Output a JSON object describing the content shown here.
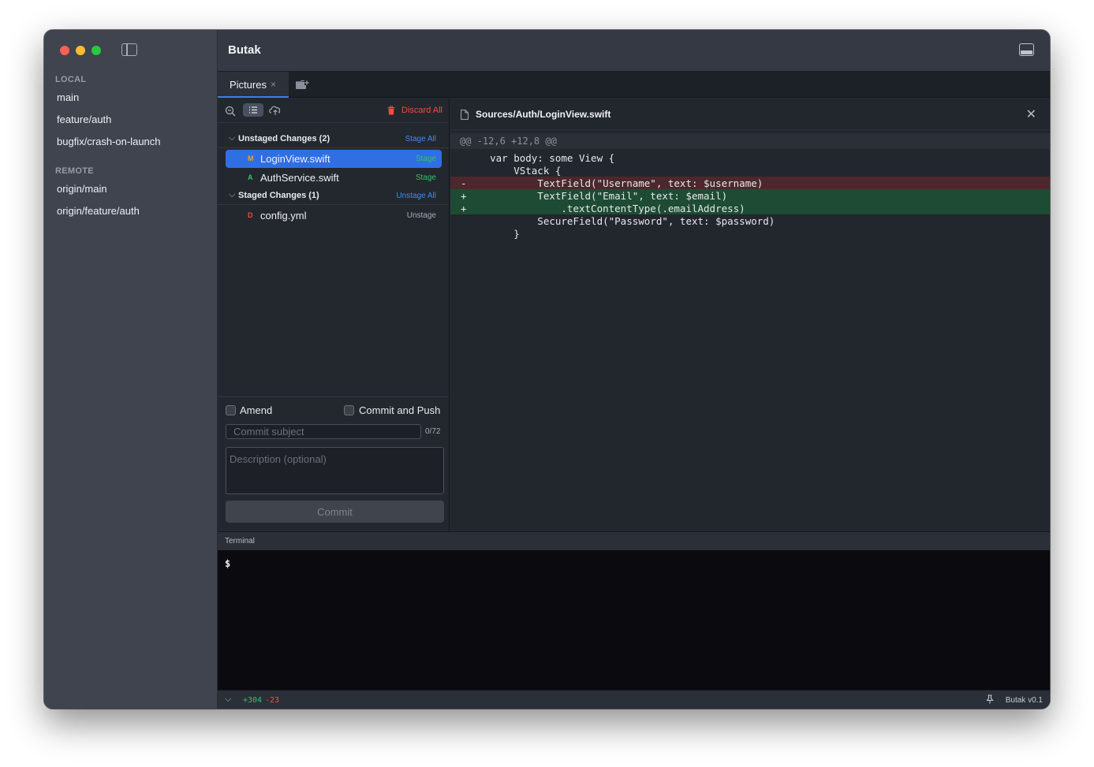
{
  "sidebar": {
    "local_title": "LOCAL",
    "local_branches": [
      "main",
      "feature/auth",
      "bugfix/crash-on-launch"
    ],
    "remote_title": "REMOTE",
    "remote_branches": [
      "origin/main",
      "origin/feature/auth"
    ]
  },
  "header": {
    "title": "Butak"
  },
  "tabs": [
    {
      "label": "Pictures",
      "close": "×"
    }
  ],
  "toolbar": {
    "discard_all": "Discard All"
  },
  "unstaged": {
    "title": "Unstaged Changes (2)",
    "action": "Stage All",
    "files": [
      {
        "status": "M",
        "status_color": "#f0a030",
        "name": "LoginView.swift",
        "action": "Stage",
        "selected": true
      },
      {
        "status": "A",
        "status_color": "#36c26e",
        "name": "AuthService.swift",
        "action": "Stage",
        "selected": false
      }
    ]
  },
  "staged": {
    "title": "Staged Changes (1)",
    "action": "Unstage All",
    "files": [
      {
        "status": "D",
        "status_color": "#ef4c43",
        "name": "config.yml",
        "action": "Unstage",
        "selected": false
      }
    ]
  },
  "commit": {
    "amend_label": "Amend",
    "push_label": "Commit and Push",
    "subject_placeholder": "Commit subject",
    "char_count": "0/72",
    "description_placeholder": "Description (optional)",
    "button_label": "Commit"
  },
  "diff": {
    "path": "Sources/Auth/LoginView.swift",
    "hunk_header": "@@ -12,6 +12,8 @@",
    "lines": [
      {
        "type": "context",
        "marker": " ",
        "text": "    var body: some View {"
      },
      {
        "type": "context",
        "marker": " ",
        "text": "        VStack {"
      },
      {
        "type": "removed",
        "marker": "-",
        "text": "            TextField(\"Username\", text: $username)"
      },
      {
        "type": "added",
        "marker": "+",
        "text": "            TextField(\"Email\", text: $email)"
      },
      {
        "type": "added",
        "marker": "+",
        "text": "                .textContentType(.emailAddress)"
      },
      {
        "type": "context",
        "marker": " ",
        "text": "            SecureField(\"Password\", text: $password)"
      },
      {
        "type": "context",
        "marker": " ",
        "text": "        }"
      }
    ]
  },
  "terminal": {
    "label": "Terminal",
    "prompt": "$"
  },
  "status": {
    "additions": "+304",
    "deletions": "-23",
    "version": "Butak v0.1"
  },
  "colors": {
    "accent": "#3d7df0",
    "stage_green": "#34c06b",
    "unstage_gray": "#a7abb4",
    "discard_red": "#ef4c43"
  },
  "icons": [
    "sidebar-toggle-icon",
    "panel-toggle-icon",
    "new-tab-icon",
    "zoom-out-icon",
    "list-view-icon",
    "cloud-upload-icon",
    "trash-icon",
    "chevron-down-icon",
    "document-icon",
    "close-icon",
    "pin-icon"
  ]
}
